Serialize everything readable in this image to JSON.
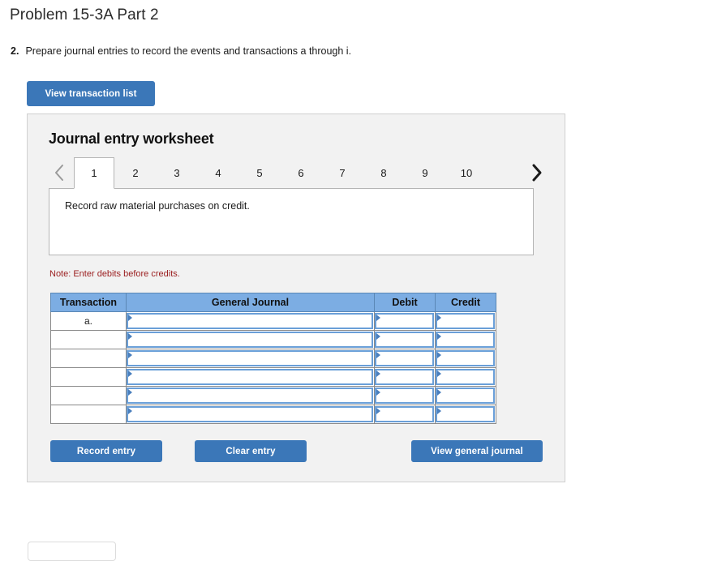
{
  "page": {
    "title": "Problem 15-3A Part 2"
  },
  "prompt": {
    "number": "2.",
    "text": "Prepare journal entries to record the events and transactions a through i."
  },
  "toolbar": {
    "view_transaction_list_label": "View transaction list"
  },
  "worksheet": {
    "title": "Journal entry worksheet",
    "prev_icon": "chevron-left-icon",
    "next_icon": "chevron-right-icon",
    "tabs": [
      {
        "label": "1",
        "active": true
      },
      {
        "label": "2",
        "active": false
      },
      {
        "label": "3",
        "active": false
      },
      {
        "label": "4",
        "active": false
      },
      {
        "label": "5",
        "active": false
      },
      {
        "label": "6",
        "active": false
      },
      {
        "label": "7",
        "active": false
      },
      {
        "label": "8",
        "active": false
      },
      {
        "label": "9",
        "active": false
      },
      {
        "label": "10",
        "active": false
      }
    ],
    "description": "Record raw material purchases on credit.",
    "note": "Note: Enter debits before credits.",
    "note_color": "#9b1f20"
  },
  "journal": {
    "headers": [
      "Transaction",
      "General Journal",
      "Debit",
      "Credit"
    ],
    "header_bg": "#7cade3",
    "rows": [
      {
        "transaction": "a.",
        "general_journal": "",
        "debit": "",
        "credit": ""
      },
      {
        "transaction": "",
        "general_journal": "",
        "debit": "",
        "credit": ""
      },
      {
        "transaction": "",
        "general_journal": "",
        "debit": "",
        "credit": ""
      },
      {
        "transaction": "",
        "general_journal": "",
        "debit": "",
        "credit": ""
      },
      {
        "transaction": "",
        "general_journal": "",
        "debit": "",
        "credit": ""
      },
      {
        "transaction": "",
        "general_journal": "",
        "debit": "",
        "credit": ""
      }
    ]
  },
  "actions": {
    "record_entry_label": "Record entry",
    "clear_entry_label": "Clear entry",
    "view_general_journal_label": "View general journal",
    "button_color": "#3b77b8"
  }
}
